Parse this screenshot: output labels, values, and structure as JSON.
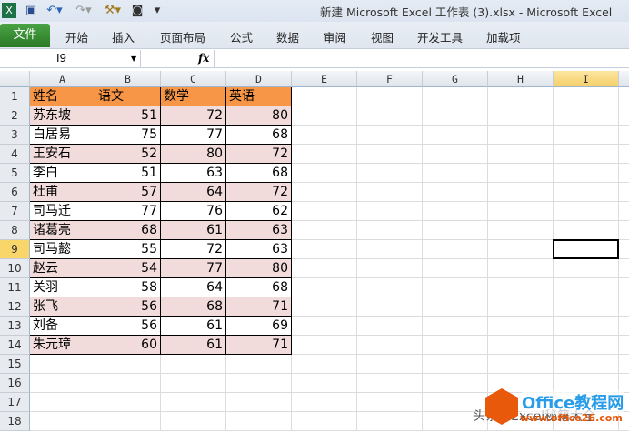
{
  "window": {
    "title": "新建 Microsoft Excel 工作表 (3).xlsx - Microsoft Excel"
  },
  "ribbon": {
    "file": "文件",
    "tabs": [
      "开始",
      "插入",
      "页面布局",
      "公式",
      "数据",
      "审阅",
      "视图",
      "开发工具",
      "加载项"
    ]
  },
  "formula_bar": {
    "name_box": "I9",
    "fx": "fx",
    "value": ""
  },
  "columns": [
    "A",
    "B",
    "C",
    "D",
    "E",
    "F",
    "G",
    "H",
    "I"
  ],
  "selected": {
    "col": "I",
    "row": 9
  },
  "table": {
    "headers": [
      "姓名",
      "语文",
      "数学",
      "英语"
    ],
    "rows": [
      [
        "苏东坡",
        51,
        72,
        80
      ],
      [
        "白居易",
        75,
        77,
        68
      ],
      [
        "王安石",
        52,
        80,
        72
      ],
      [
        "李白",
        51,
        63,
        68
      ],
      [
        "杜甫",
        57,
        64,
        72
      ],
      [
        "司马迁",
        77,
        76,
        62
      ],
      [
        "诸葛亮",
        68,
        61,
        63
      ],
      [
        "司马懿",
        55,
        72,
        63
      ],
      [
        "赵云",
        54,
        77,
        80
      ],
      [
        "关羽",
        58,
        64,
        68
      ],
      [
        "张飞",
        56,
        68,
        71
      ],
      [
        "刘备",
        56,
        61,
        69
      ],
      [
        "朱元璋",
        60,
        61,
        71
      ]
    ]
  },
  "row_count": 18,
  "colors": {
    "header": "#f79646",
    "band": "#f2dcdb",
    "file_tab": "#2f7d2a"
  },
  "watermark": {
    "brand": "Office教程网",
    "url": "www.office26.com",
    "author": "头条@Excel秘籍大全"
  }
}
